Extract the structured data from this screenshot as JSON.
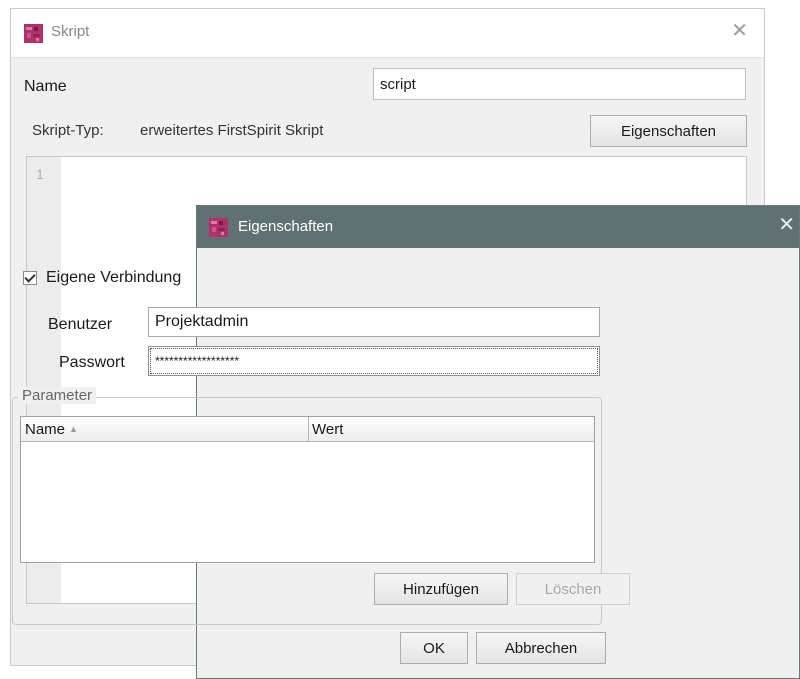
{
  "skript_window": {
    "title": "Skript",
    "name_label": "Name",
    "name_value": "script",
    "type_label": "Skript-Typ:",
    "type_value": "erweitertes FirstSpirit Skript",
    "properties_button": "Eigenschaften",
    "editor_line": "1"
  },
  "dialog": {
    "title": "Eigenschaften",
    "own_connection_label": "Eigene Verbindung",
    "own_connection_checked": true,
    "user_label": "Benutzer",
    "user_value": "Projektadmin",
    "password_label": "Passwort",
    "password_value": "******************",
    "parameter_legend": "Parameter",
    "table_headers": [
      "Name",
      "Wert"
    ],
    "add_button": "Hinzufügen",
    "delete_button": "Löschen",
    "ok_button": "OK",
    "cancel_button": "Abbrechen"
  },
  "colors": {
    "dialog_titlebar": "#5f7172",
    "brand_logo": "#b0306a"
  },
  "icons": {
    "logo": "firstspirit-logo-icon",
    "close": "close-icon",
    "sort": "sort-asc-icon"
  }
}
